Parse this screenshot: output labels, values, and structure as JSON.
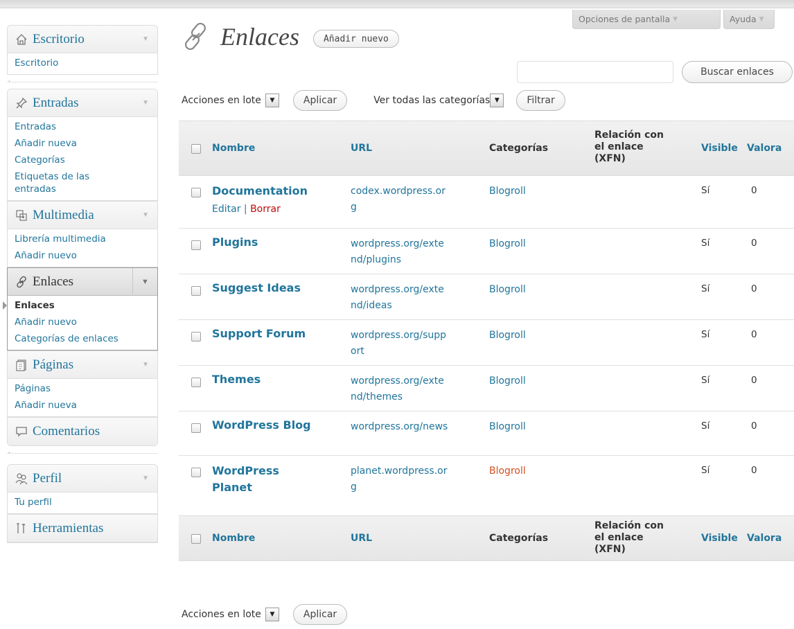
{
  "header": {
    "screen_options": "Opciones de pantalla",
    "help": "Ayuda"
  },
  "page": {
    "title": "Enlaces",
    "add_new": "Añadir nuevo",
    "search_button": "Buscar enlaces",
    "search_value": ""
  },
  "sidebar": {
    "groups": [
      {
        "label": "Escritorio",
        "items": [
          "Escritorio"
        ]
      },
      {
        "label": "Entradas",
        "items": [
          "Entradas",
          "Añadir nueva",
          "Categorías",
          "Etiquetas de las entradas"
        ]
      },
      {
        "label": "Multimedia",
        "items": [
          "Librería multimedia",
          "Añadir nuevo"
        ]
      },
      {
        "label": "Enlaces",
        "items": [
          "Enlaces",
          "Añadir nuevo",
          "Categorías de enlaces"
        ]
      },
      {
        "label": "Páginas",
        "items": [
          "Páginas",
          "Añadir nueva"
        ]
      },
      {
        "label": "Comentarios",
        "items": []
      },
      {
        "label": "Perfil",
        "items": [
          "Tu perfil"
        ]
      },
      {
        "label": "Herramientas",
        "items": []
      }
    ]
  },
  "toolbar": {
    "bulk_actions": "Acciones en lote",
    "apply": "Aplicar",
    "categories_filter": "Ver todas las categorías",
    "filter": "Filtrar"
  },
  "table": {
    "headers": {
      "name": "Nombre",
      "url": "URL",
      "categories": "Categorías",
      "relation_1": "Relación con",
      "relation_2": "el enlace",
      "relation_3": "(XFN)",
      "visible": "Visible",
      "rating": "Valora"
    },
    "row_actions": {
      "edit": "Editar",
      "separator": "|",
      "delete": "Borrar"
    },
    "rows": [
      {
        "name": "Documentation",
        "url_1": "codex.wordpress.or",
        "url_2": "g",
        "category": "Blogroll",
        "visible": "Sí",
        "rating": "0"
      },
      {
        "name": "Plugins",
        "url_1": "wordpress.org/exte",
        "url_2": "nd/plugins",
        "category": "Blogroll",
        "visible": "Sí",
        "rating": "0"
      },
      {
        "name": "Suggest Ideas",
        "url_1": "wordpress.org/exte",
        "url_2": "nd/ideas",
        "category": "Blogroll",
        "visible": "Sí",
        "rating": "0"
      },
      {
        "name": "Support Forum",
        "url_1": "wordpress.org/supp",
        "url_2": "ort",
        "category": "Blogroll",
        "visible": "Sí",
        "rating": "0"
      },
      {
        "name": "Themes",
        "url_1": "wordpress.org/exte",
        "url_2": "nd/themes",
        "category": "Blogroll",
        "visible": "Sí",
        "rating": "0"
      },
      {
        "name": "WordPress Blog",
        "url_1": "wordpress.org/news",
        "url_2": "",
        "category": "Blogroll",
        "visible": "Sí",
        "rating": "0"
      },
      {
        "name_1": "WordPress",
        "name_2": "Planet",
        "url_1": "planet.wordpress.or",
        "url_2": "g",
        "category": "Blogroll",
        "visible": "Sí",
        "rating": "0"
      }
    ]
  },
  "colors": {
    "link": "#21759b",
    "delete": "#bc0b0b",
    "highlight": "#d54e21"
  }
}
